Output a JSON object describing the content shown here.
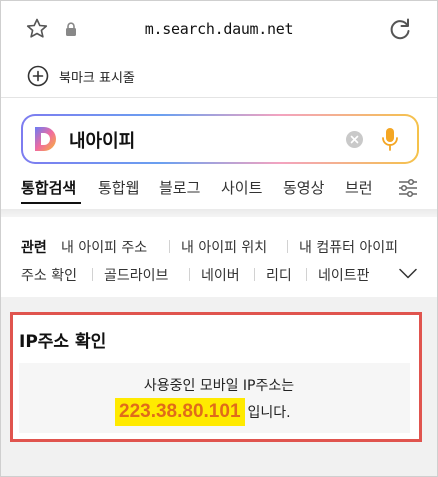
{
  "browser": {
    "url": "m.search.daum.net",
    "icons": [
      "star-icon",
      "lock-icon",
      "reload-icon"
    ]
  },
  "bookmark_bar": {
    "label": "북마크 표시줄",
    "icon": "plus-circle-icon"
  },
  "search": {
    "query": "내아이피",
    "logo": "daum-logo-icon",
    "clear_icon": "clear-icon",
    "mic_icon": "mic-icon",
    "gradient_colors": [
      "#7d7cf0",
      "#6aa0f0",
      "#f3a3c0",
      "#f5c24a"
    ]
  },
  "tabs": [
    {
      "label": "통합검색",
      "active": true
    },
    {
      "label": "통합웹",
      "active": false
    },
    {
      "label": "블로그",
      "active": false
    },
    {
      "label": "사이트",
      "active": false
    },
    {
      "label": "동영상",
      "active": false
    },
    {
      "label": "브런",
      "active": false
    }
  ],
  "related": {
    "heading": "관련",
    "row1": [
      "내 아이피 주소",
      "내 아이피 위치",
      "내 컴퓨터 아이피"
    ],
    "row2": [
      "주소 확인",
      "골드라이브",
      "네이버",
      "리디",
      "네이트판"
    ]
  },
  "ip_card": {
    "title": "IP주소 확인",
    "description": "사용중인 모바일 IP주소는",
    "ip_address": "223.38.80.101",
    "suffix": "입니다.",
    "highlight_color": "#ffea00",
    "ip_text_color": "#e06b1a",
    "box_border_color": "#e0544e"
  }
}
